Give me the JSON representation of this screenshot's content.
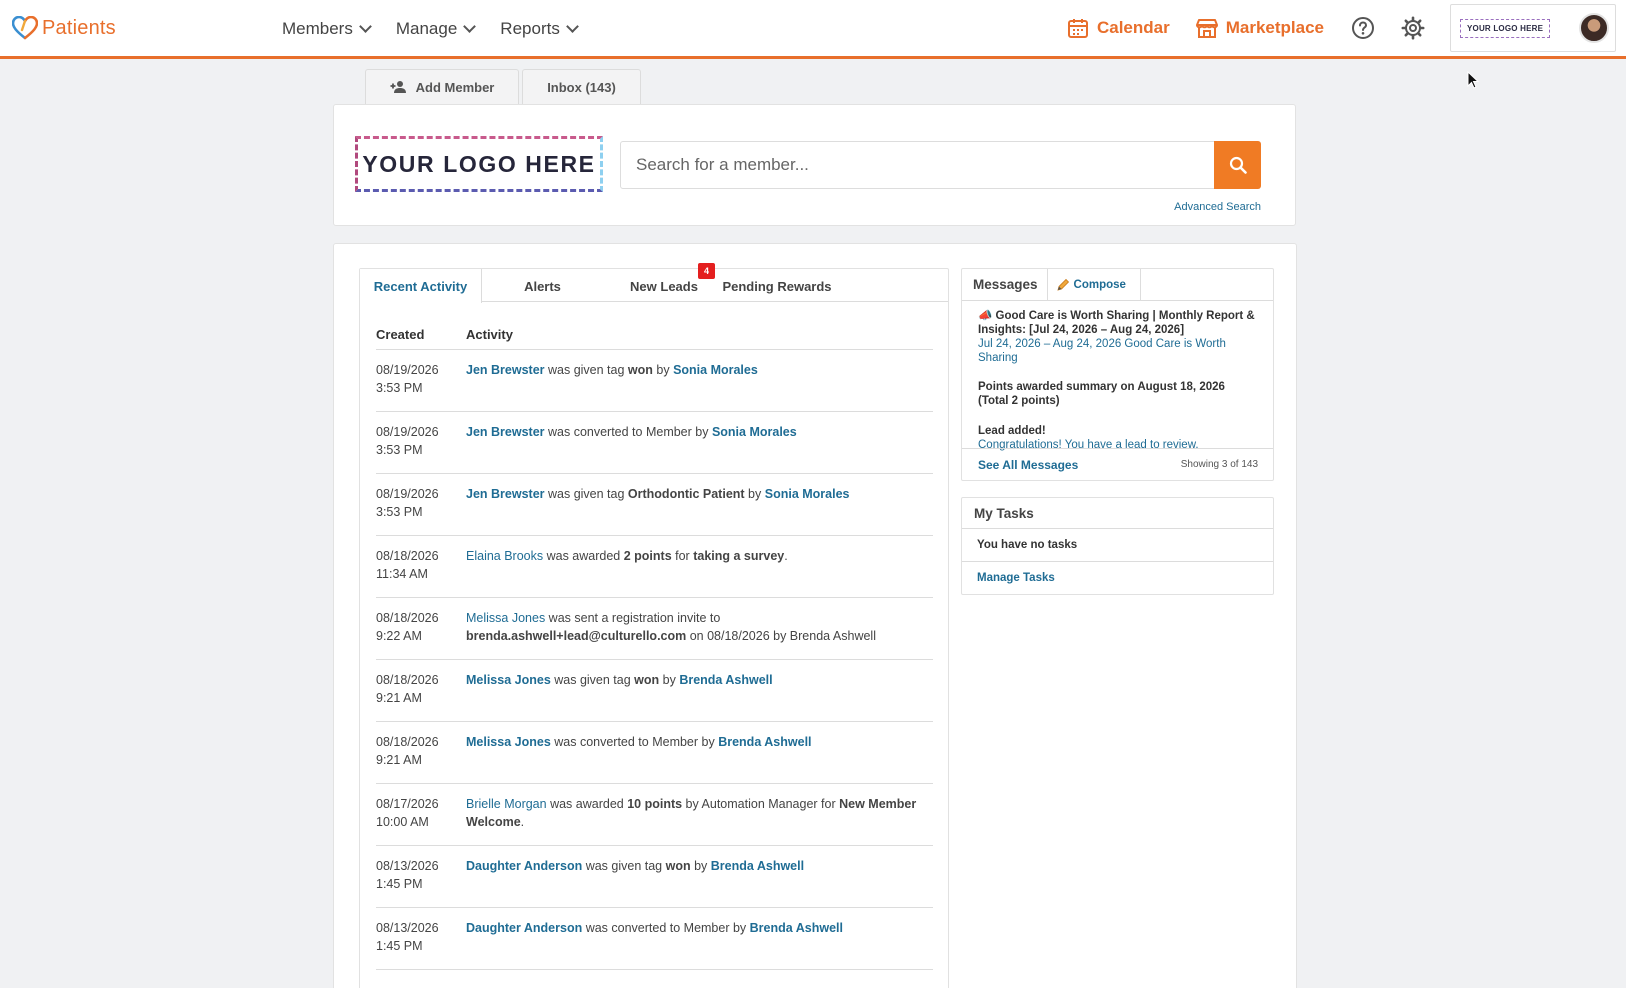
{
  "app": {
    "brand": "Patients"
  },
  "nav": [
    {
      "label": "Members"
    },
    {
      "label": "Manage"
    },
    {
      "label": "Reports"
    }
  ],
  "top_right": {
    "calendar": "Calendar",
    "marketplace": "Marketplace",
    "account_logo": "YOUR LOGO HERE"
  },
  "top_tabs": {
    "add_member": "Add Member",
    "inbox": "Inbox (143)"
  },
  "search": {
    "logo_text": "YOUR LOGO HERE",
    "placeholder": "Search for a member...",
    "advanced": "Advanced Search"
  },
  "activity_tabs": {
    "recent": "Recent Activity",
    "alerts": "Alerts",
    "new_leads": "New Leads",
    "new_leads_badge": "4",
    "pending": "Pending Rewards"
  },
  "activity": {
    "headers": {
      "created": "Created",
      "activity": "Activity"
    },
    "rows": [
      {
        "date": "08/19/2026",
        "time": "3:53 PM",
        "parts": [
          [
            "Jen Brewster",
            "lb"
          ],
          [
            " was given tag ",
            ""
          ],
          [
            "won",
            "b"
          ],
          [
            " by ",
            ""
          ],
          [
            "Sonia Morales",
            "lb"
          ]
        ]
      },
      {
        "date": "08/19/2026",
        "time": "3:53 PM",
        "parts": [
          [
            "Jen Brewster",
            "lb"
          ],
          [
            " was converted to Member by ",
            ""
          ],
          [
            "Sonia Morales",
            "lb"
          ]
        ]
      },
      {
        "date": "08/19/2026",
        "time": "3:53 PM",
        "parts": [
          [
            "Jen Brewster",
            "lb"
          ],
          [
            " was given tag ",
            ""
          ],
          [
            "Orthodontic Patient",
            "b"
          ],
          [
            " by ",
            ""
          ],
          [
            "Sonia Morales",
            "lb"
          ]
        ]
      },
      {
        "date": "08/18/2026",
        "time": "11:34 AM",
        "parts": [
          [
            "Elaina Brooks",
            "l"
          ],
          [
            " was awarded ",
            ""
          ],
          [
            "2 points",
            "b"
          ],
          [
            " for ",
            ""
          ],
          [
            "taking a survey",
            "b"
          ],
          [
            ".",
            ""
          ]
        ]
      },
      {
        "date": "08/18/2026",
        "time": "9:22 AM",
        "parts": [
          [
            "Melissa Jones",
            "l"
          ],
          [
            " was sent a registration invite to ",
            ""
          ],
          [
            "brenda.ashwell+lead@culturello.com",
            "b"
          ],
          [
            " on 08/18/2026 by Brenda Ashwell",
            ""
          ]
        ]
      },
      {
        "date": "08/18/2026",
        "time": "9:21 AM",
        "parts": [
          [
            "Melissa Jones",
            "lb"
          ],
          [
            " was given tag ",
            ""
          ],
          [
            "won",
            "b"
          ],
          [
            " by ",
            ""
          ],
          [
            "Brenda Ashwell",
            "lb"
          ]
        ]
      },
      {
        "date": "08/18/2026",
        "time": "9:21 AM",
        "parts": [
          [
            "Melissa Jones",
            "lb"
          ],
          [
            " was converted to Member by ",
            ""
          ],
          [
            "Brenda Ashwell",
            "lb"
          ]
        ]
      },
      {
        "date": "08/17/2026",
        "time": "10:00 AM",
        "parts": [
          [
            "Brielle Morgan",
            "l"
          ],
          [
            " was awarded ",
            ""
          ],
          [
            "10 points",
            "b"
          ],
          [
            " by Automation Manager for ",
            ""
          ],
          [
            "New Member Welcome",
            "b"
          ],
          [
            ".",
            ""
          ]
        ]
      },
      {
        "date": "08/13/2026",
        "time": "1:45 PM",
        "parts": [
          [
            "Daughter Anderson",
            "lb"
          ],
          [
            " was given tag ",
            ""
          ],
          [
            "won",
            "b"
          ],
          [
            " by ",
            ""
          ],
          [
            "Brenda Ashwell",
            "lb"
          ]
        ]
      },
      {
        "date": "08/13/2026",
        "time": "1:45 PM",
        "parts": [
          [
            "Daughter Anderson",
            "lb"
          ],
          [
            " was converted to Member by ",
            ""
          ],
          [
            "Brenda Ashwell",
            "lb"
          ]
        ]
      }
    ]
  },
  "messages": {
    "title": "Messages",
    "compose": "Compose",
    "items": [
      {
        "title": "Good Care is Worth Sharing | Monthly Report & Insights: [Jul 24, 2026 – Aug 24, 2026]",
        "sub": "Jul 24, 2026 – Aug 24, 2026 Good Care is Worth Sharing"
      },
      {
        "title": "Points awarded summary on August 18, 2026 (Total 2 points)",
        "sub": ""
      },
      {
        "title": "Lead added!",
        "sub": "Congratulations! You have a lead to review."
      }
    ],
    "see_all": "See All Messages",
    "showing": "Showing 3 of 143"
  },
  "tasks": {
    "title": "My Tasks",
    "empty": "You have no tasks",
    "manage": "Manage Tasks"
  },
  "colors": {
    "accent": "#e86f2c",
    "link": "#1f6c94",
    "search_button": "#f07b24",
    "badge": "#e41f1f"
  }
}
